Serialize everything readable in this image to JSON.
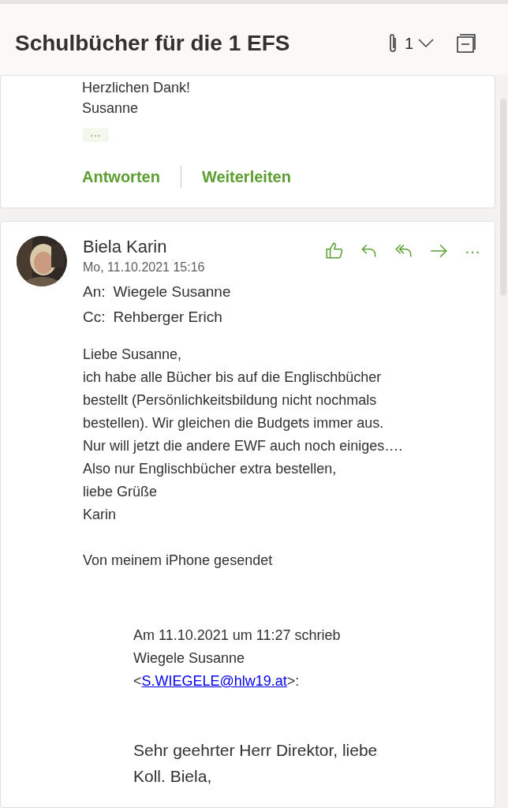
{
  "header": {
    "title": "Schulbücher für die 1 EFS",
    "attachment_count": "1"
  },
  "messages": [
    {
      "kind": "collapsed",
      "body_lines": [
        "Herzlichen Dank!",
        "Susanne"
      ],
      "more": "···",
      "actions": [
        "Antworten",
        "Weiterleiten"
      ]
    },
    {
      "kind": "expanded",
      "sender": "Biela Karin",
      "date": "Mo, 11.10.2021 15:16",
      "to_label": "An:",
      "to": "Wiegele Susanne",
      "cc_label": "Cc:",
      "cc": "Rehberger Erich",
      "more": "···",
      "body_lines": [
        "Liebe Susanne,",
        "ich habe alle Bücher bis auf die Englischbücher",
        "bestellt (Persönlichkeitsbildung nicht nochmals",
        "bestellen). Wir gleichen die Budgets immer aus.",
        "Nur will jetzt die andere EWF auch noch einiges….",
        "Also nur Englischbücher extra bestellen,",
        "liebe Grüße",
        "Karin"
      ],
      "signature": "Von meinem iPhone gesendet",
      "quote": {
        "lines": [
          "Am 11.10.2021 um 11:27 schrieb",
          "Wiegele Susanne"
        ],
        "email_open": "<",
        "email": "S.WIEGELE@hlw19.at",
        "email_close": ">:",
        "greeting_lines": [
          "Sehr geehrter Herr Direktor, liebe",
          "Koll. Biela,"
        ]
      }
    }
  ]
}
